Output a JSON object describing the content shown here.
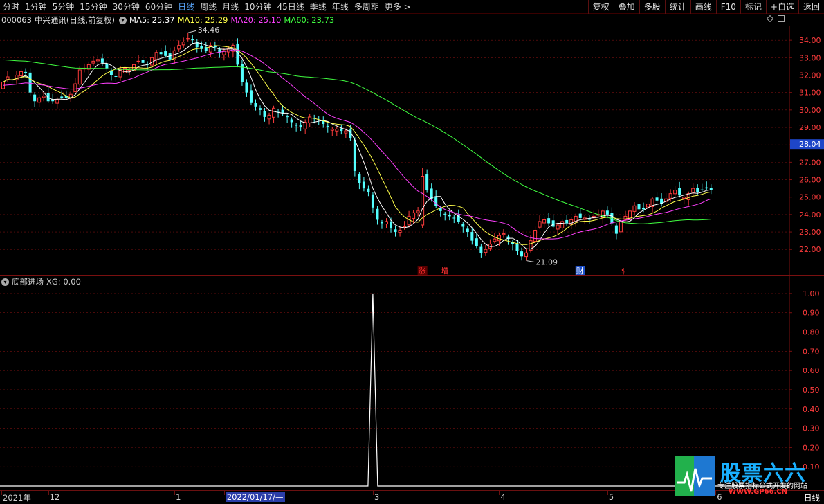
{
  "toolbar": {
    "timeframes": [
      {
        "label": "分时",
        "active": false
      },
      {
        "label": "1分钟",
        "active": false
      },
      {
        "label": "5分钟",
        "active": false
      },
      {
        "label": "15分钟",
        "active": false
      },
      {
        "label": "30分钟",
        "active": false
      },
      {
        "label": "60分钟",
        "active": false
      },
      {
        "label": "日线",
        "active": true
      },
      {
        "label": "周线",
        "active": false
      },
      {
        "label": "月线",
        "active": false
      },
      {
        "label": "10分钟",
        "active": false
      },
      {
        "label": "45日线",
        "active": false
      },
      {
        "label": "季线",
        "active": false
      },
      {
        "label": "年线",
        "active": false
      },
      {
        "label": "多周期",
        "active": false
      },
      {
        "label": "更多 >",
        "active": false
      }
    ],
    "tools": [
      "复权",
      "叠加",
      "多股",
      "统计",
      "画线",
      "F10",
      "标记",
      "+自选",
      "返回"
    ]
  },
  "stock": {
    "code": "000063",
    "name": "中兴通讯",
    "mode": "(日线,前复权)"
  },
  "ma": [
    {
      "label": "MA5: 25.37",
      "color": "#ffffff"
    },
    {
      "label": "MA10: 25.29",
      "color": "#ffff4a"
    },
    {
      "label": "MA20: 25.10",
      "color": "#ff40ff"
    },
    {
      "label": "MA60: 23.73",
      "color": "#40ff40"
    }
  ],
  "indicator": {
    "name": "底部进场",
    "value_label": "XG: 0.00"
  },
  "annotations": {
    "high_label": "34.46",
    "low_label": "21.09",
    "markers": [
      {
        "text": "涨",
        "color": "#ff3030",
        "bg": "#5a0000",
        "index": 93
      },
      {
        "text": "增",
        "color": "#ff3030",
        "bg": "",
        "index": 98
      },
      {
        "text": "财",
        "color": "#ffffff",
        "bg": "#1e50c8",
        "index": 128
      },
      {
        "text": "$",
        "color": "#ff3030",
        "bg": "",
        "index": 138
      }
    ]
  },
  "date_axis": {
    "labels": [
      {
        "text": "2021年",
        "index": 0,
        "selected": false
      },
      {
        "text": "12",
        "index": 10,
        "selected": false
      },
      {
        "text": "1",
        "index": 38,
        "selected": false
      },
      {
        "text": "2022/01/17/—",
        "index": 49,
        "selected": true
      },
      {
        "text": "3",
        "index": 82,
        "selected": false
      },
      {
        "text": "4",
        "index": 110,
        "selected": false
      },
      {
        "text": "5",
        "index": 134,
        "selected": false
      },
      {
        "text": "6",
        "index": 158,
        "selected": false
      }
    ],
    "period": "日线"
  },
  "watermark": {
    "title": "股票六六",
    "slogan": "专注股票指标公式开发的网站",
    "url": "WWW.GP66.CN"
  },
  "colors": {
    "up": "#ff3c3c",
    "down": "#54ffff",
    "grid": "#7a1010",
    "axis_text": "#ff3c3c",
    "current_price_bg": "#1e46c8"
  },
  "chart_data": [
    {
      "type": "candlestick",
      "title": "",
      "ylim": [
        20.5,
        34.8
      ],
      "yticks": [
        "34.00",
        "33.00",
        "32.00",
        "31.00",
        "30.00",
        "29.00",
        "28.00",
        "27.00",
        "26.00",
        "25.00",
        "24.00",
        "23.00",
        "22.00"
      ],
      "current_price": "28.04",
      "closes": [
        31.6,
        31.9,
        31.7,
        32.0,
        32.2,
        32.1,
        31.0,
        30.5,
        30.7,
        30.8,
        30.5,
        30.5,
        30.6,
        30.7,
        30.7,
        30.9,
        31.5,
        32.3,
        32.4,
        32.6,
        32.8,
        32.9,
        32.7,
        32.4,
        32.0,
        31.9,
        32.3,
        32.4,
        32.3,
        32.6,
        32.8,
        32.7,
        32.6,
        33.0,
        33.3,
        33.2,
        33.1,
        32.9,
        33.4,
        33.7,
        33.9,
        34.1,
        34.0,
        33.6,
        33.5,
        33.4,
        33.7,
        33.6,
        33.3,
        33.4,
        33.5,
        33.7,
        32.6,
        31.6,
        31.0,
        30.4,
        30.2,
        30.0,
        29.6,
        29.7,
        30.1,
        29.9,
        29.8,
        29.6,
        29.3,
        29.1,
        29.0,
        29.3,
        29.6,
        29.5,
        29.4,
        29.2,
        29.0,
        28.9,
        28.9,
        28.8,
        28.8,
        28.4,
        26.5,
        25.8,
        25.5,
        25.3,
        24.4,
        23.7,
        23.5,
        23.6,
        23.2,
        23.0,
        23.1,
        23.3,
        23.9,
        24.1,
        24.2,
        26.2,
        25.4,
        24.9,
        24.5,
        24.2,
        24.0,
        23.9,
        23.8,
        23.6,
        23.3,
        23.0,
        22.5,
        22.2,
        21.8,
        22.0,
        22.3,
        22.6,
        22.8,
        22.9,
        22.6,
        22.3,
        21.9,
        21.6,
        21.8,
        22.5,
        23.1,
        23.6,
        23.7,
        23.5,
        23.3,
        23.4,
        23.6,
        23.5,
        23.7,
        23.9,
        23.8,
        23.8,
        23.7,
        23.9,
        24.0,
        24.2,
        24.0,
        23.5,
        22.9,
        23.6,
        23.9,
        24.2,
        24.5,
        24.3,
        24.3,
        24.6,
        24.9,
        24.8,
        24.6,
        24.9,
        25.2,
        25.4,
        25.1,
        25.0,
        25.2,
        25.5,
        25.3,
        25.4,
        25.5,
        25.4
      ]
    },
    {
      "type": "line",
      "title": "",
      "ylim": [
        0,
        1.05
      ],
      "yticks": [
        "1.00",
        "0.90",
        "0.80",
        "0.70",
        "0.60",
        "0.50",
        "0.40",
        "0.30",
        "0.20",
        "0.10"
      ],
      "signal_index": 82,
      "value": 1.0
    }
  ]
}
